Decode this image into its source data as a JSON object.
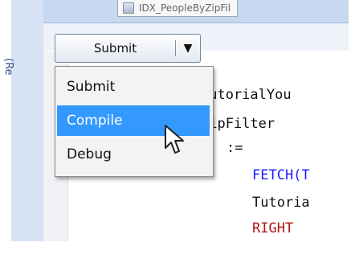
{
  "window": {
    "side_panel_label": "(Re",
    "tab_title": "IDX_PeopleByZipFil"
  },
  "toolbar": {
    "submit_label": "Submit",
    "dropdown_glyph": "▼"
  },
  "menu": {
    "items": [
      {
        "label": "Submit"
      },
      {
        "label": "Compile"
      },
      {
        "label": "Debug"
      }
    ],
    "selected_index": 1
  },
  "editor": {
    "lines": [
      "TutorialYou",
      "ZipFilter",
      ":=",
      "FETCH(T",
      "Tutoria",
      "RIGHT"
    ]
  },
  "colors": {
    "keyword_blue": "#1c1cff",
    "keyword_red": "#b01818",
    "selection_bg": "#3399ff"
  },
  "icons": {
    "cursor": "mouse-pointer-icon",
    "tab": "document-icon",
    "dropdown": "chevron-down-icon"
  }
}
